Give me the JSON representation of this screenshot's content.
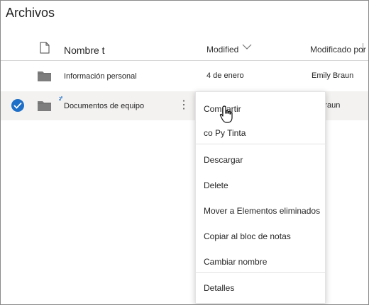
{
  "title": "Archivos",
  "columns": {
    "name": "Nombre t",
    "modified": "Modified",
    "modified_by": "Modificado por"
  },
  "rows": [
    {
      "name": "Información personal",
      "modified": "4 de enero",
      "modified_by": "Emily Braun"
    },
    {
      "name": "Documentos de equipo",
      "modified": "",
      "modified_by": "ly Braun",
      "selected": true
    }
  ],
  "menu": {
    "items": [
      "Compartir",
      "co  Py   Tinta",
      "Descargar",
      "Delete",
      "Mover a Elementos eliminados",
      "Copiar al bloc de notas",
      "Cambiar nombre",
      "Detalles"
    ]
  },
  "colors": {
    "accent": "#1e6fc7",
    "folder": "#7d7d7d",
    "selected_row": "#f3f2f1"
  }
}
